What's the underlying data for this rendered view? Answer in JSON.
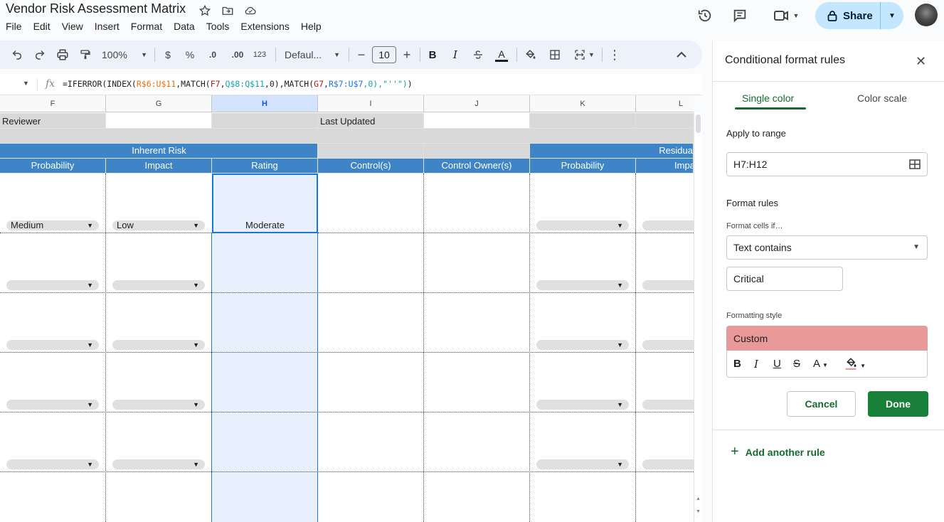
{
  "document": {
    "title": "Vendor Risk Assessment Matrix"
  },
  "menu": [
    "File",
    "Edit",
    "View",
    "Insert",
    "Format",
    "Data",
    "Tools",
    "Extensions",
    "Help"
  ],
  "header": {
    "share_label": "Share"
  },
  "toolbar": {
    "zoom": "100%",
    "currency": "$",
    "percent": "%",
    "decrease_decimal": ".0",
    "increase_decimal": ".00",
    "number_format": "123",
    "font": "Defaul...",
    "font_size": "10",
    "bold": "B",
    "italic": "I",
    "text_color_glyph": "A"
  },
  "formula_bar": {
    "fx": "fx",
    "parts": [
      {
        "text": "=IFERROR(INDEX(",
        "cls": ""
      },
      {
        "text": "R$6:U$11",
        "cls": "ref-a"
      },
      {
        "text": ",MATCH(",
        "cls": ""
      },
      {
        "text": "F7",
        "cls": "ref-d"
      },
      {
        "text": ",",
        "cls": ""
      },
      {
        "text": "Q$8:Q$11",
        "cls": "ref-b"
      },
      {
        "text": ",0),MATCH(",
        "cls": ""
      },
      {
        "text": "G7",
        "cls": "ref-d"
      },
      {
        "text": ",",
        "cls": ""
      },
      {
        "text": "R$7:U$7",
        "cls": "ref-c"
      },
      {
        "text": ",0),\"''\")",
        "cls": "ref-b"
      },
      {
        "text": ")",
        "cls": ""
      }
    ]
  },
  "sheet": {
    "columns": [
      {
        "letter": "F",
        "selected": false
      },
      {
        "letter": "G",
        "selected": false
      },
      {
        "letter": "H",
        "selected": true
      },
      {
        "letter": "I",
        "selected": false
      },
      {
        "letter": "J",
        "selected": false
      },
      {
        "letter": "K",
        "selected": false
      },
      {
        "letter": "L",
        "selected": false
      }
    ],
    "reviewer_label": "Reviewer",
    "last_updated_label": "Last Updated",
    "group_inherent": "Inherent Risk",
    "group_residual": "Residua",
    "headers": [
      "Probability",
      "Impact",
      "Rating",
      "Control(s)",
      "Control Owner(s)",
      "Probability",
      "Impa"
    ],
    "row1": {
      "probability": "Medium",
      "impact": "Low",
      "rating": "Moderate"
    }
  },
  "panel": {
    "title": "Conditional format rules",
    "tab_single": "Single color",
    "tab_scale": "Color scale",
    "apply_label": "Apply to range",
    "range_value": "H7:H12",
    "format_rules_label": "Format rules",
    "format_cells_if": "Format cells if…",
    "condition": "Text contains",
    "condition_value": "Critical",
    "formatting_style": "Formatting style",
    "style_name": "Custom",
    "style_color": "#ea9999",
    "cancel": "Cancel",
    "done": "Done",
    "add_rule": "Add another rule"
  },
  "colors": {
    "accent_green": "#188038",
    "header_blue": "#3d85c6",
    "share_blue": "#c2e7ff"
  }
}
